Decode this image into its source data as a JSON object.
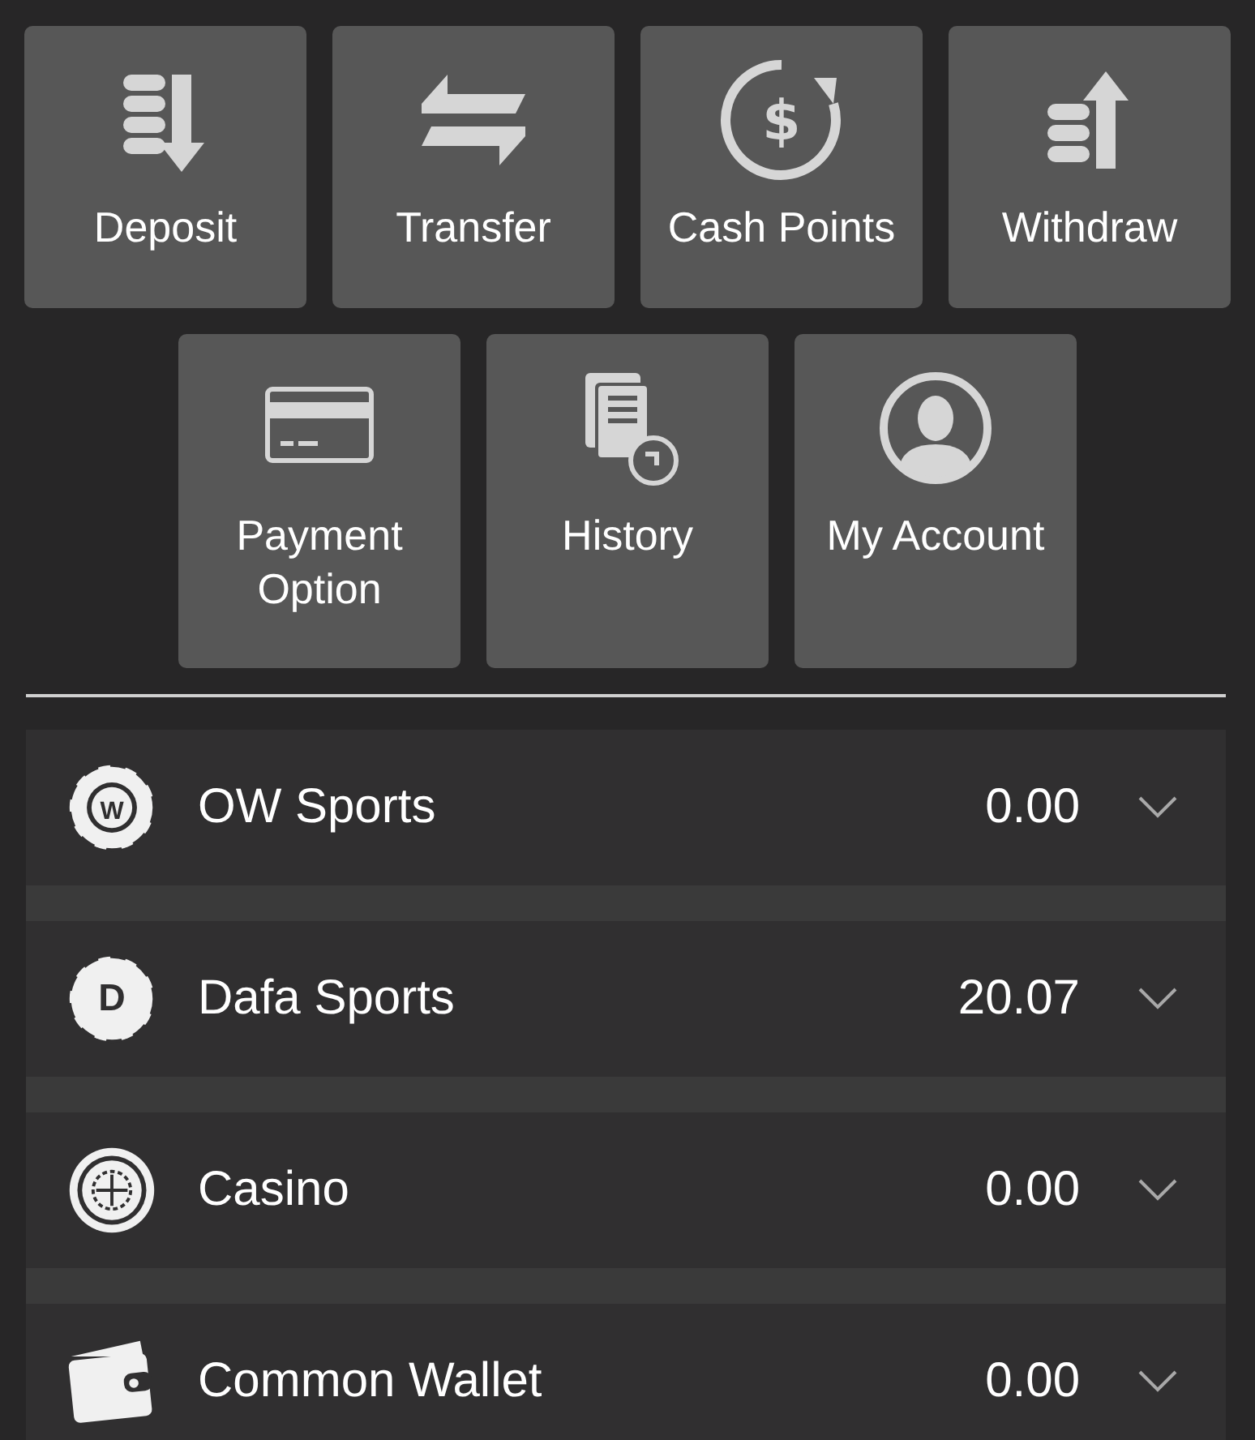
{
  "actions": [
    {
      "kind": "deposit",
      "label": "Deposit"
    },
    {
      "kind": "transfer",
      "label": "Transfer"
    },
    {
      "kind": "cash-points",
      "icon_symbol": "$",
      "label": "Cash Points"
    },
    {
      "kind": "withdraw",
      "label": "Withdraw"
    },
    {
      "kind": "payment",
      "label": "Payment Option"
    },
    {
      "kind": "history",
      "label": "History"
    },
    {
      "kind": "account",
      "label": "My Account"
    }
  ],
  "wallets": [
    {
      "kind": "ball-w",
      "icon_letter": "W",
      "name": "OW Sports",
      "balance": "0.00"
    },
    {
      "kind": "ball-d",
      "icon_letter": "D",
      "name": "Dafa Sports",
      "balance": "20.07"
    },
    {
      "kind": "roulette",
      "name": "Casino",
      "balance": "0.00"
    },
    {
      "kind": "wallet",
      "name": "Common Wallet",
      "balance": "0.00"
    }
  ]
}
